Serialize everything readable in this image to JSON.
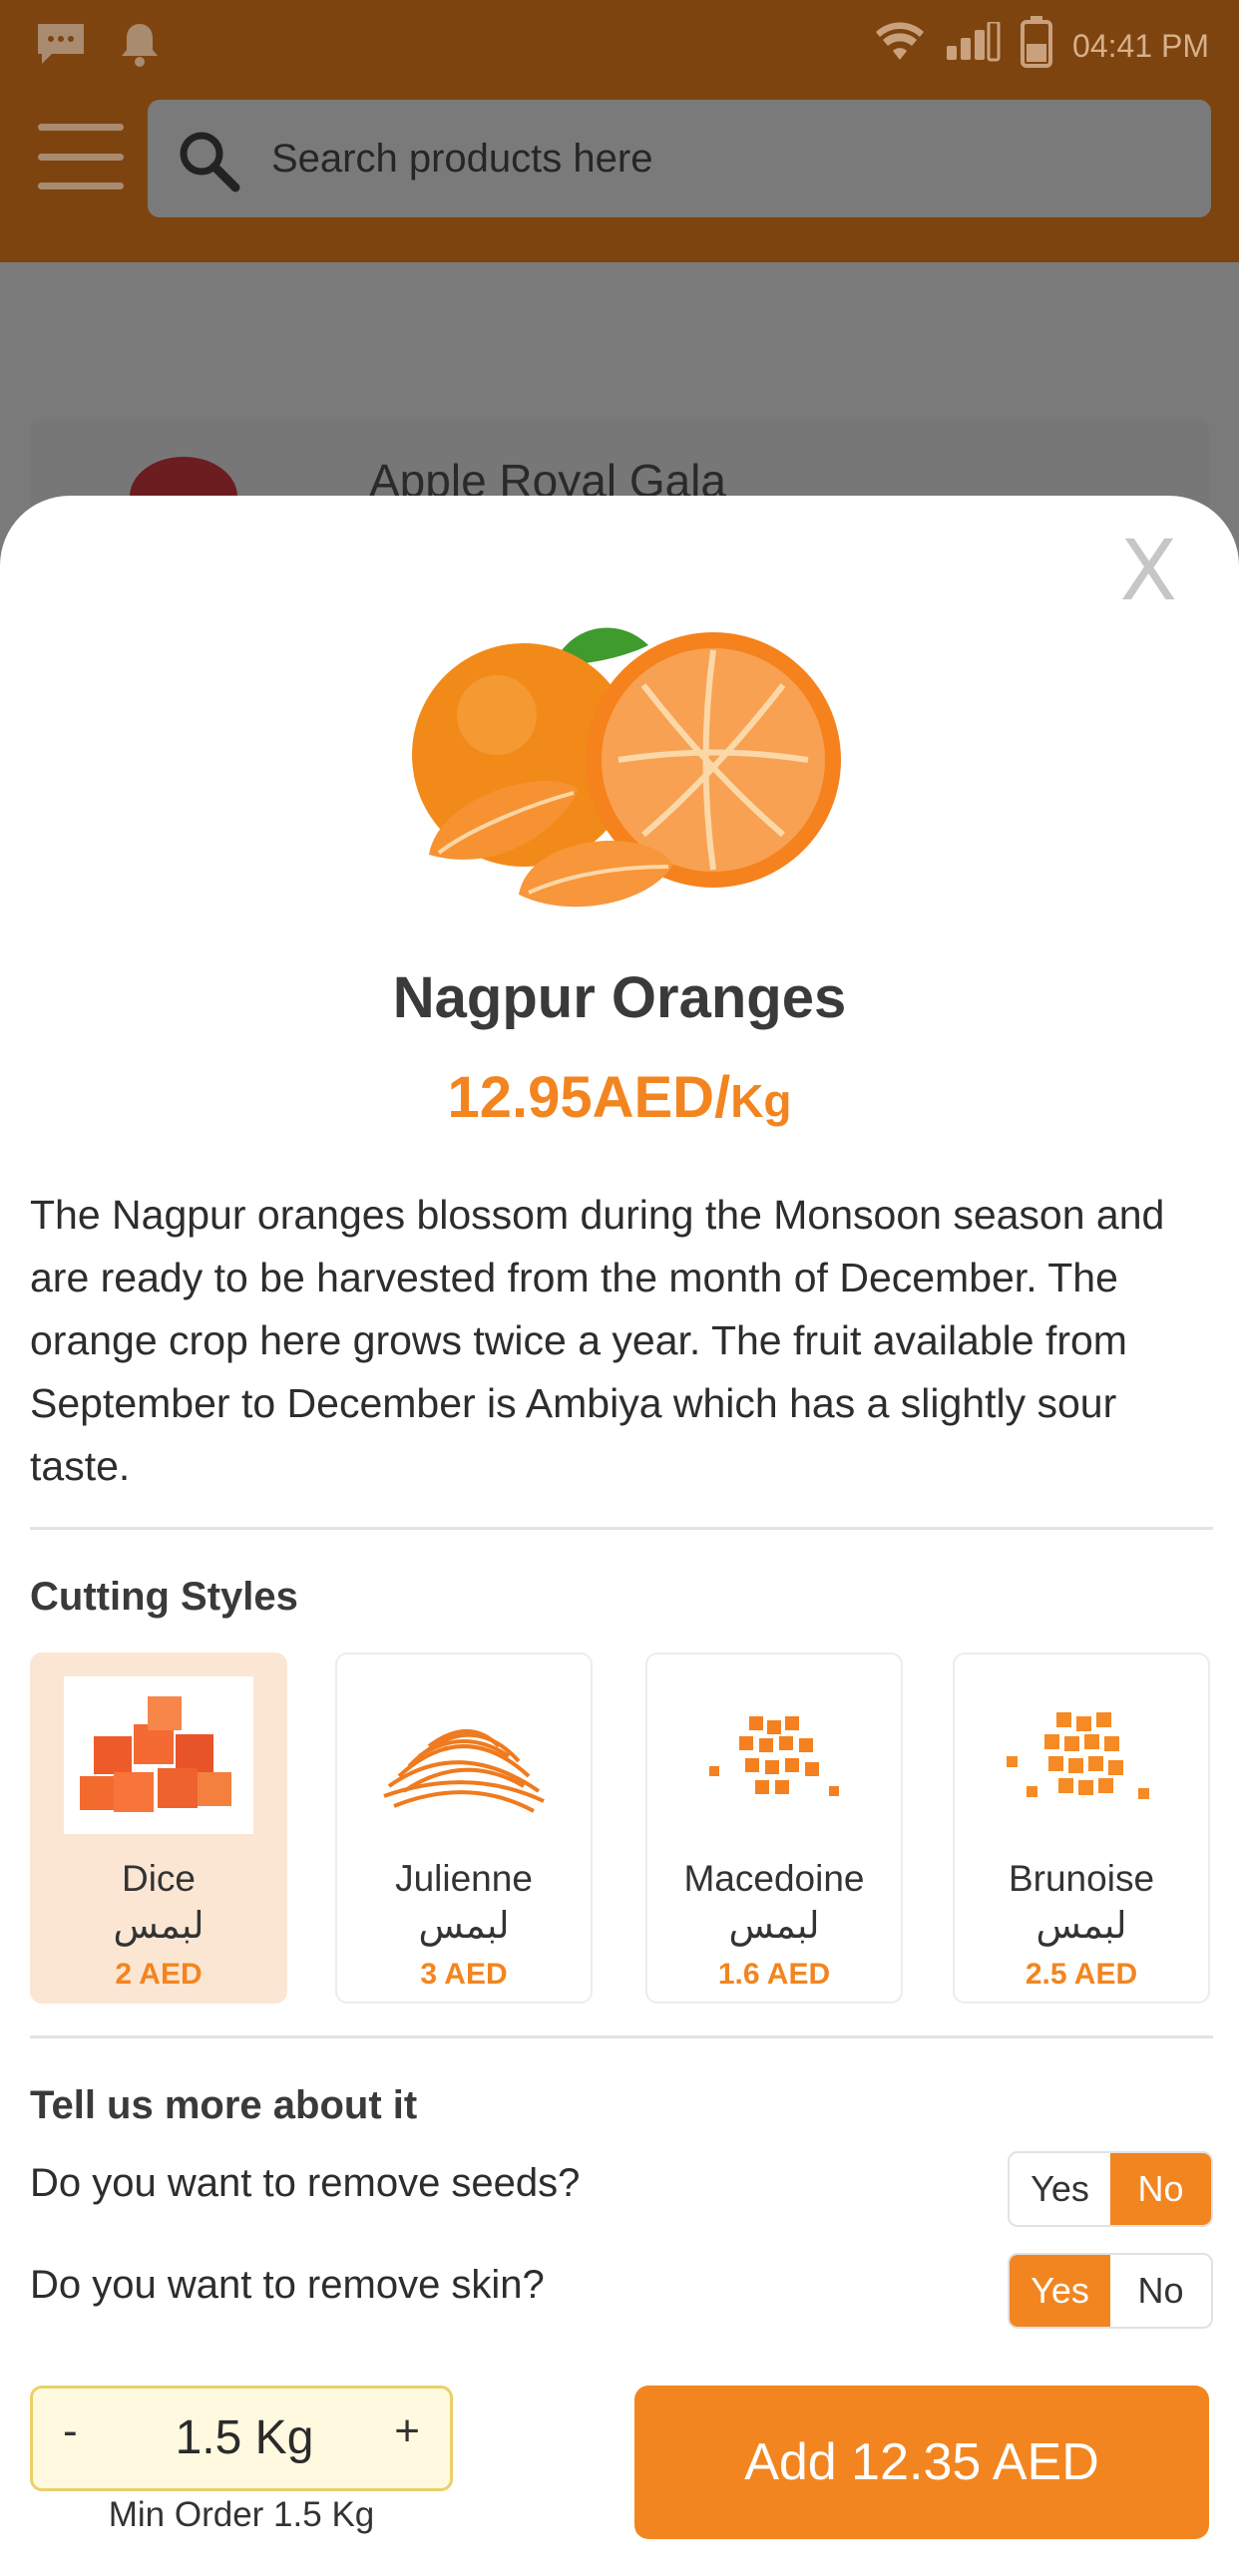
{
  "status_bar": {
    "time": "04:41 PM"
  },
  "header": {
    "search_placeholder": "Search products here"
  },
  "background_list": {
    "item_title": "Apple Royal Gala"
  },
  "product": {
    "name": "Nagpur Oranges",
    "price_amount": "12.95AED/",
    "price_unit": "Kg",
    "description": "The Nagpur oranges blossom during the Monsoon season and are ready to be harvested from the month of December. The orange crop here grows twice a year. The fruit available from September to December is Ambiya which has a slightly sour taste."
  },
  "close_label": "X",
  "cutting_styles": {
    "title": "Cutting Styles",
    "items": [
      {
        "name": "Dice",
        "arabic": "لبمس",
        "price": "2 AED",
        "selected": true
      },
      {
        "name": "Julienne",
        "arabic": "لبمس",
        "price": "3 AED",
        "selected": false
      },
      {
        "name": "Macedoine",
        "arabic": "لبمس",
        "price": "1.6 AED",
        "selected": false
      },
      {
        "name": "Brunoise",
        "arabic": "لبمس",
        "price": "2.5 AED",
        "selected": false
      }
    ]
  },
  "preferences": {
    "title": "Tell us more about it",
    "questions": [
      {
        "text": "Do you want to remove seeds?",
        "yes": "Yes",
        "no": "No",
        "selected": "No"
      },
      {
        "text": "Do you want to remove skin?",
        "yes": "Yes",
        "no": "No",
        "selected": "Yes"
      }
    ]
  },
  "quantity": {
    "minus": "-",
    "value": "1.5 Kg",
    "plus": "+",
    "min_order": "Min Order 1.5 Kg"
  },
  "add_button": "Add 12.35 AED",
  "colors": {
    "accent": "#f2851f",
    "header": "#7e4410",
    "overlay": "#7a7a7a"
  }
}
